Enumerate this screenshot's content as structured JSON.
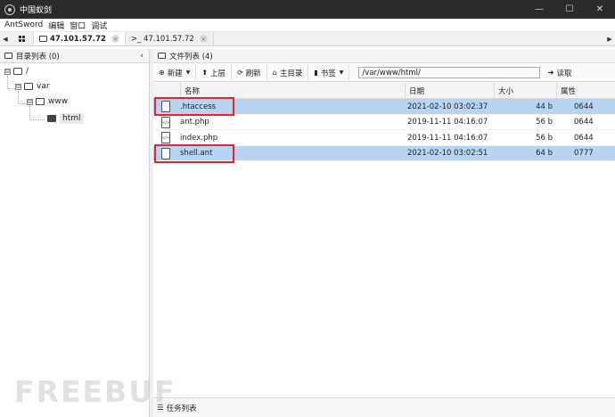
{
  "window": {
    "title": "中国蚁剑",
    "controls": {
      "minimize": "—",
      "maximize": "☐",
      "close": "✕"
    }
  },
  "menu": [
    "AntSword",
    "编辑",
    "窗口",
    "调试"
  ],
  "tabs": [
    {
      "label": "47.101.57.72",
      "active": true,
      "icon": "folder-icon"
    },
    {
      "label": ">_ 47.101.57.72",
      "active": false,
      "icon": "terminal-icon"
    }
  ],
  "left_panel": {
    "title": "目录列表 (0)",
    "tree": [
      {
        "label": "/",
        "toggle": "⊟"
      },
      {
        "label": "var",
        "toggle": "⊟"
      },
      {
        "label": "www",
        "toggle": "⊟"
      },
      {
        "label": "html",
        "toggle": ""
      }
    ]
  },
  "right_panel": {
    "title": "文件列表 (4)",
    "toolbar": {
      "new": "新建",
      "up": "上层",
      "refresh": "刷新",
      "home": "主目录",
      "bookmark": "书签",
      "path": "/var/www/html/",
      "read": "读取"
    },
    "columns": {
      "name": "名称",
      "date": "日期",
      "size": "大小",
      "attr": "属性"
    },
    "files": [
      {
        "name": ".htaccess",
        "date": "2021-02-10 03:02:37",
        "size": "44 b",
        "attr": "0644",
        "icon": "file-icon",
        "highlighted": true,
        "boxed": true
      },
      {
        "name": "ant.php",
        "date": "2019-11-11 04:16:07",
        "size": "56 b",
        "attr": "0644",
        "icon": "code-file-icon",
        "highlighted": false,
        "boxed": false
      },
      {
        "name": "index.php",
        "date": "2019-11-11 04:16:07",
        "size": "56 b",
        "attr": "0644",
        "icon": "code-file-icon",
        "highlighted": false,
        "boxed": false
      },
      {
        "name": "shell.ant",
        "date": "2021-02-10 03:02:51",
        "size": "64 b",
        "attr": "0777",
        "icon": "file-icon",
        "highlighted": true,
        "boxed": true
      }
    ]
  },
  "taskbar": {
    "label": "任务列表"
  },
  "watermark": "FREEBUF",
  "colors": {
    "titlebar": "#2b2b2b",
    "selection": "#b8d4f3",
    "annotation": "#e3242b"
  }
}
